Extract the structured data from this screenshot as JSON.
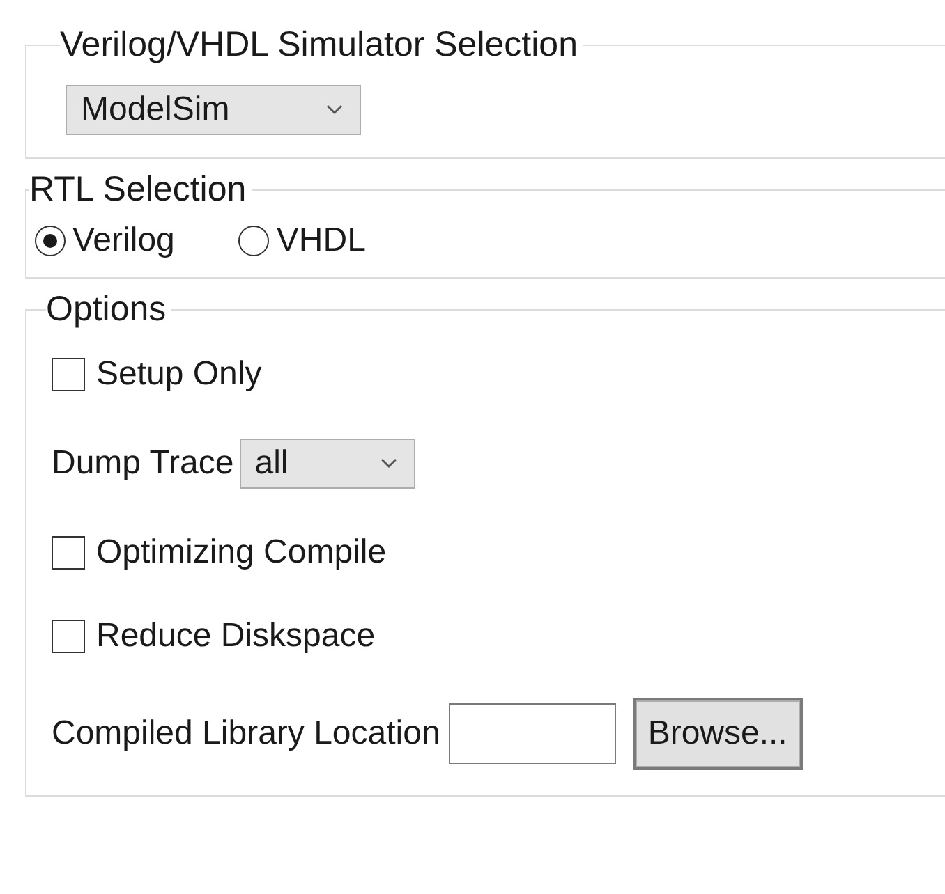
{
  "simulator_group": {
    "title": "Verilog/VHDL Simulator Selection",
    "simulator": {
      "value": "ModelSim"
    }
  },
  "rtl_group": {
    "title": "RTL Selection",
    "options": [
      {
        "label": "Verilog",
        "selected": true
      },
      {
        "label": "VHDL",
        "selected": false
      }
    ]
  },
  "options_group": {
    "title": "Options",
    "items": [
      {
        "kind": "checkbox",
        "label": "Setup Only",
        "checked": false
      },
      {
        "kind": "dropdown",
        "label": "Dump Trace",
        "value": "all"
      },
      {
        "kind": "checkbox",
        "label": "Optimizing Compile",
        "checked": false
      },
      {
        "kind": "checkbox",
        "label": "Reduce Diskspace",
        "checked": false
      },
      {
        "kind": "path",
        "label": "Compiled Library Location",
        "button": "Browse..."
      }
    ]
  }
}
